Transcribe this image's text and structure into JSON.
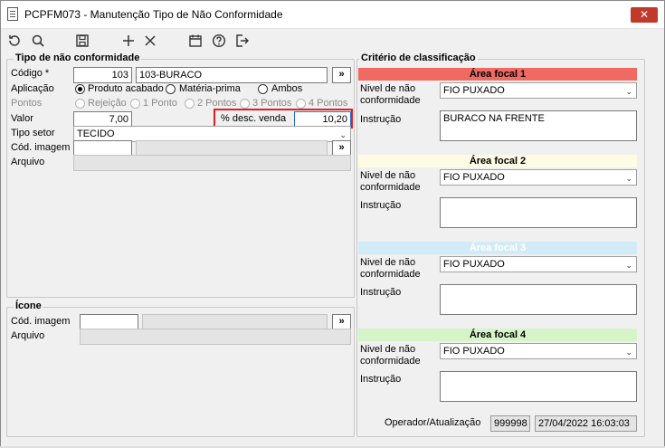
{
  "window": {
    "title": "PCPFM073 - Manutenção Tipo de Não Conformidade",
    "close_label": "✕"
  },
  "toolbar": {
    "undo_icon": "refresh-ccw-icon",
    "search_icon": "search-icon",
    "save_icon": "save-icon",
    "add_icon": "plus-icon",
    "delete_icon": "x-icon",
    "calendar_icon": "calendar-icon",
    "help_icon": "help-icon",
    "exit_icon": "logout-icon"
  },
  "tipo": {
    "legend": "Tipo de não conformidade",
    "codigo_label": "Código *",
    "codigo_value": "103",
    "descricao_value": "103-BURACO",
    "lookup_label": "»",
    "aplicacao_label": "Aplicação",
    "aplicacao_options": [
      "Produto acabado",
      "Matéria-prima",
      "Ambos"
    ],
    "pontos_label": "Pontos",
    "pontos_options": [
      "Rejeição",
      "1 Ponto",
      "2 Pontos",
      "3 Pontos",
      "4 Pontos"
    ],
    "valor_label": "Valor",
    "valor_value": "7,00",
    "desc_venda_label": "% desc. venda",
    "desc_venda_value": "10,20",
    "tipo_setor_label": "Tipo setor",
    "tipo_setor_value": "TECIDO",
    "cod_imagem_label": "Cód. imagem",
    "cod_imagem_value": "",
    "imagem_lookup_label": "»",
    "arquivo_label": "Arquivo",
    "arquivo_value": ""
  },
  "icone": {
    "legend": "Ícone",
    "cod_imagem_label": "Cód. imagem",
    "cod_imagem_value": "",
    "lookup_label": "»",
    "arquivo_label": "Arquivo",
    "arquivo_value": ""
  },
  "criterio": {
    "legend": "Critério de classificação",
    "areas": [
      {
        "title": "Área focal 1",
        "color": "#f06a62",
        "nivel_label": "Nivel de não conformidade",
        "nivel_value": "FIO PUXADO",
        "instrucao_label": "Instrução",
        "instrucao_value": "BURACO NA FRENTE"
      },
      {
        "title": "Área focal 2",
        "color": "#fdfbe3",
        "nivel_label": "Nivel de não conformidade",
        "nivel_value": "FIO PUXADO",
        "instrucao_label": "Instrução",
        "instrucao_value": ""
      },
      {
        "title": "Área focal 3",
        "color": "#d2ecf7",
        "nivel_label": "Nivel de não conformidade",
        "nivel_value": "FIO PUXADO",
        "instrucao_label": "Instrução",
        "instrucao_value": ""
      },
      {
        "title": "Área focal 4",
        "color": "#d5f5c8",
        "nivel_label": "Nivel de não conformidade",
        "nivel_value": "FIO PUXADO",
        "instrucao_label": "Instrução",
        "instrucao_value": ""
      }
    ],
    "operador_label": "Operador/Atualização",
    "operador_value": "999998",
    "data_value": "27/04/2022 16:03:03"
  }
}
